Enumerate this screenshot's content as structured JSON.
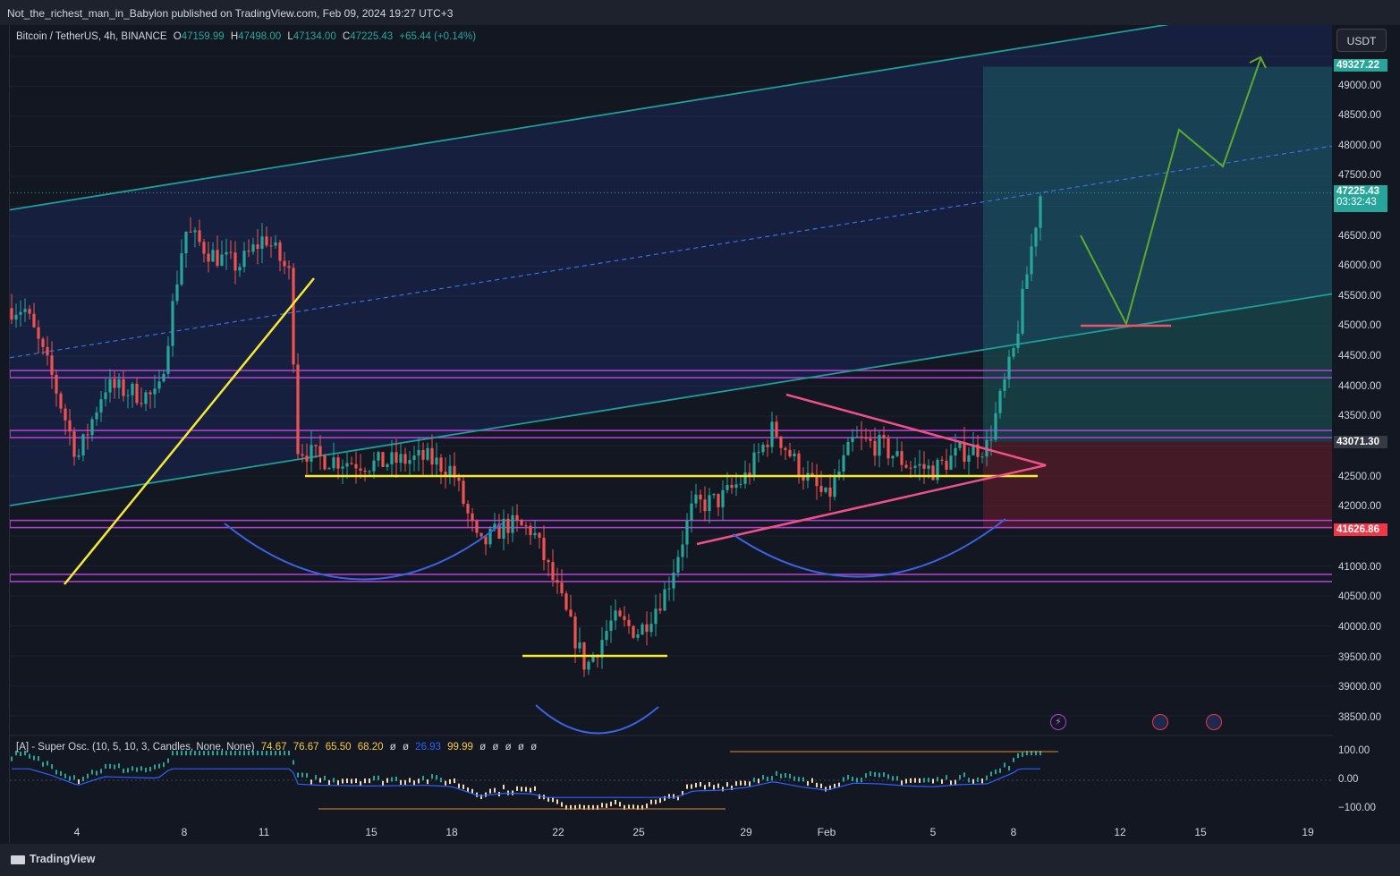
{
  "header": {
    "publisher": "Not_the_richest_man_in_Babylon published on TradingView.com, Feb 09, 2024 19:27 UTC+3"
  },
  "legend": {
    "symbol": "Bitcoin / TetherUS, 4h, BINANCE",
    "open_label": "O",
    "open": "47159.99",
    "high_label": "H",
    "high": "47498.00",
    "low_label": "L",
    "low": "47134.00",
    "close_label": "C",
    "close": "47225.43",
    "change": "+65.44 (+0.14%)"
  },
  "oscillator": {
    "name": "[A] - Super Osc. (10, 5, 10, 3, Candles, None, None)",
    "values": [
      "74.67",
      "76.67",
      "65.50",
      "68.20",
      "ø",
      "ø",
      "26.93",
      "99.99",
      "ø",
      "ø",
      "ø",
      "ø",
      "ø"
    ],
    "axis_ticks": [
      "100.00",
      "0.00",
      "−100.00"
    ]
  },
  "price_axis": {
    "currency": "USDT",
    "ticks": [
      "49000.00",
      "48500.00",
      "48000.00",
      "47500.00",
      "46500.00",
      "46000.00",
      "45500.00",
      "45000.00",
      "44500.00",
      "44000.00",
      "43500.00",
      "42500.00",
      "42000.00",
      "41000.00",
      "40500.00",
      "40000.00",
      "39500.00",
      "39000.00",
      "38500.00"
    ],
    "labels": {
      "target": "49327.22",
      "current": "47225.43",
      "countdown": "03:32:43",
      "entry": "43071.30",
      "stop": "41626.86"
    },
    "colors": {
      "target": "#26a69a",
      "current": "#26a69a",
      "entry": "#363a45",
      "stop": "#f23645"
    }
  },
  "time_axis": {
    "ticks": [
      "4",
      "8",
      "11",
      "15",
      "18",
      "22",
      "25",
      "29",
      "Feb",
      "5",
      "8",
      "12",
      "15",
      "19"
    ]
  },
  "footer": {
    "brand": "TradingView"
  },
  "chart_data": {
    "type": "candlestick",
    "symbol": "Bitcoin / TetherUS",
    "interval": "4h",
    "exchange": "BINANCE",
    "ylim": [
      38300,
      49700
    ],
    "x_ticks": [
      "4",
      "8",
      "11",
      "15",
      "18",
      "22",
      "25",
      "29",
      "Feb",
      "5",
      "8",
      "12",
      "15",
      "19"
    ],
    "colors": {
      "up": "#26a69a",
      "down": "#ef5350",
      "channel": "#1e9e96",
      "level": "#b03fd4",
      "support": "#f5e935",
      "triangle": "#f0508a",
      "arc": "#3b63e0",
      "projection": "#5fa82e"
    },
    "waypoints": [
      {
        "date": "Jan 2",
        "price": 45300
      },
      {
        "date": "Jan 3",
        "price": 44200
      },
      {
        "date": "Jan 4",
        "price": 42800
      },
      {
        "date": "Jan 5",
        "price": 44000
      },
      {
        "date": "Jan 7",
        "price": 43800
      },
      {
        "date": "Jan 8",
        "price": 46600
      },
      {
        "date": "Jan 9",
        "price": 46200
      },
      {
        "date": "Jan 10",
        "price": 46000
      },
      {
        "date": "Jan 11",
        "price": 46500
      },
      {
        "date": "Jan 12",
        "price": 45800
      },
      {
        "date": "Jan 12",
        "price": 43000
      },
      {
        "date": "Jan 13",
        "price": 42800
      },
      {
        "date": "Jan 15",
        "price": 42700
      },
      {
        "date": "Jan 17",
        "price": 42800
      },
      {
        "date": "Jan 18",
        "price": 42600
      },
      {
        "date": "Jan 19",
        "price": 41300
      },
      {
        "date": "Jan 20",
        "price": 41700
      },
      {
        "date": "Jan 21",
        "price": 41600
      },
      {
        "date": "Jan 22",
        "price": 40500
      },
      {
        "date": "Jan 23",
        "price": 39300
      },
      {
        "date": "Jan 24",
        "price": 40100
      },
      {
        "date": "Jan 25",
        "price": 39900
      },
      {
        "date": "Jan 26",
        "price": 40600
      },
      {
        "date": "Jan 27",
        "price": 42000
      },
      {
        "date": "Jan 28",
        "price": 42100
      },
      {
        "date": "Jan 29",
        "price": 42500
      },
      {
        "date": "Jan 30",
        "price": 43300
      },
      {
        "date": "Jan 31",
        "price": 42600
      },
      {
        "date": "Feb 1",
        "price": 42100
      },
      {
        "date": "Feb 2",
        "price": 43100
      },
      {
        "date": "Feb 3",
        "price": 43000
      },
      {
        "date": "Feb 4",
        "price": 42700
      },
      {
        "date": "Feb 5",
        "price": 42600
      },
      {
        "date": "Feb 6",
        "price": 42900
      },
      {
        "date": "Feb 7",
        "price": 43000
      },
      {
        "date": "Feb 8",
        "price": 44600
      },
      {
        "date": "Feb 9",
        "price": 47225
      }
    ],
    "horizontal_levels": [
      44200,
      43200,
      41700,
      40800
    ],
    "support_lines": [
      42500,
      39500
    ],
    "position": {
      "target": 49327.22,
      "entry": 43071.3,
      "stop": 41626.86
    }
  }
}
